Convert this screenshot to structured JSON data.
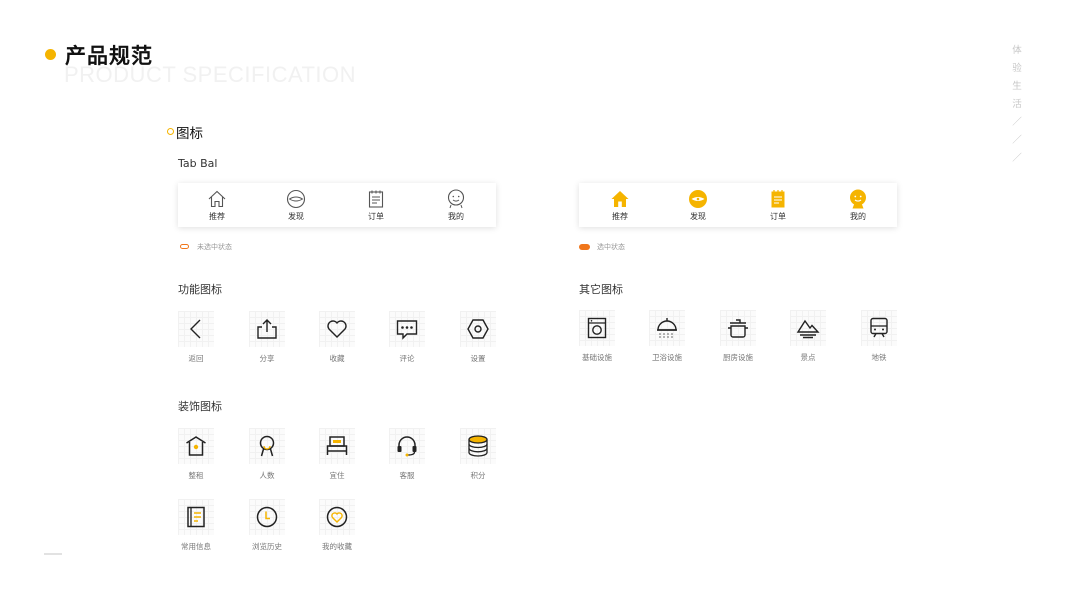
{
  "header": {
    "title": "产品规范",
    "subtitle_en": "PRODUCT SPECIFICATION"
  },
  "side_text": [
    "体",
    "验",
    "生",
    "活",
    "／",
    "／",
    "／"
  ],
  "section": {
    "title": "图标"
  },
  "tabbar": {
    "heading": "Tab Bal",
    "tabs": [
      {
        "label": "推荐",
        "icon": "home-icon"
      },
      {
        "label": "发现",
        "icon": "discover-icon"
      },
      {
        "label": "订单",
        "icon": "order-icon"
      },
      {
        "label": "我的",
        "icon": "profile-icon"
      }
    ],
    "unselected_label": "未选中状态",
    "selected_label": "选中状态",
    "colors": {
      "accent": "#F5B400",
      "legend_selected": "#F0761B",
      "legend_unselected": "#F0761B"
    }
  },
  "function_icons": {
    "heading": "功能图标",
    "items": [
      {
        "label": "返回",
        "icon": "back-icon"
      },
      {
        "label": "分享",
        "icon": "share-icon"
      },
      {
        "label": "收藏",
        "icon": "heart-icon"
      },
      {
        "label": "评论",
        "icon": "comment-icon"
      },
      {
        "label": "设置",
        "icon": "settings-icon"
      }
    ]
  },
  "other_icons": {
    "heading": "其它图标",
    "items": [
      {
        "label": "基础设施",
        "icon": "washer-icon"
      },
      {
        "label": "卫浴设施",
        "icon": "shower-icon"
      },
      {
        "label": "厨房设施",
        "icon": "pot-icon"
      },
      {
        "label": "景点",
        "icon": "mountain-icon"
      },
      {
        "label": "地铁",
        "icon": "subway-icon"
      }
    ]
  },
  "decor_icons": {
    "heading": "装饰图标",
    "items": [
      {
        "label": "整租",
        "icon": "house-icon"
      },
      {
        "label": "人数",
        "icon": "person-icon"
      },
      {
        "label": "宜住",
        "icon": "bed-icon"
      },
      {
        "label": "客服",
        "icon": "headset-icon"
      },
      {
        "label": "积分",
        "icon": "coins-icon"
      },
      {
        "label": "常用信息",
        "icon": "notebook-icon"
      },
      {
        "label": "浏览历史",
        "icon": "clock-icon"
      },
      {
        "label": "我的收藏",
        "icon": "heart-badge-icon"
      }
    ]
  }
}
